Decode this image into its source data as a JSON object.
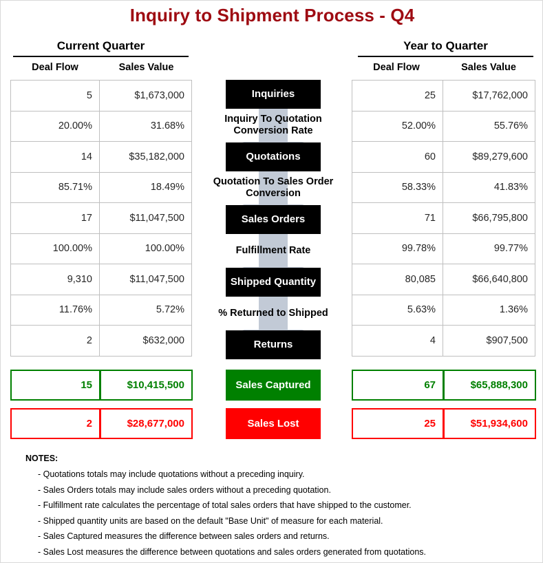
{
  "title": "Inquiry to Shipment Process - Q4",
  "colors": {
    "title": "#9E0B12",
    "stage_box": "#000000",
    "arrow": "#C2CAD6",
    "captured": "#008000",
    "lost": "#FF0000",
    "grid": "#BFBFBF"
  },
  "left_panel": {
    "header": "Current Quarter",
    "columns": [
      "Deal Flow",
      "Sales Value"
    ],
    "rows": [
      {
        "deal_flow": "5",
        "sales_value": "$1,673,000"
      },
      {
        "deal_flow": "20.00%",
        "sales_value": "31.68%"
      },
      {
        "deal_flow": "14",
        "sales_value": "$35,182,000"
      },
      {
        "deal_flow": "85.71%",
        "sales_value": "18.49%"
      },
      {
        "deal_flow": "17",
        "sales_value": "$11,047,500"
      },
      {
        "deal_flow": "100.00%",
        "sales_value": "100.00%"
      },
      {
        "deal_flow": "9,310",
        "sales_value": "$11,047,500"
      },
      {
        "deal_flow": "11.76%",
        "sales_value": "5.72%"
      },
      {
        "deal_flow": "2",
        "sales_value": "$632,000"
      }
    ],
    "captured": {
      "deal_flow": "15",
      "sales_value": "$10,415,500"
    },
    "lost": {
      "deal_flow": "2",
      "sales_value": "$28,677,000"
    }
  },
  "right_panel": {
    "header": "Year to Quarter",
    "columns": [
      "Deal Flow",
      "Sales Value"
    ],
    "rows": [
      {
        "deal_flow": "25",
        "sales_value": "$17,762,000"
      },
      {
        "deal_flow": "52.00%",
        "sales_value": "55.76%"
      },
      {
        "deal_flow": "60",
        "sales_value": "$89,279,600"
      },
      {
        "deal_flow": "58.33%",
        "sales_value": "41.83%"
      },
      {
        "deal_flow": "71",
        "sales_value": "$66,795,800"
      },
      {
        "deal_flow": "99.78%",
        "sales_value": "99.77%"
      },
      {
        "deal_flow": "80,085",
        "sales_value": "$66,640,800"
      },
      {
        "deal_flow": "5.63%",
        "sales_value": "1.36%"
      },
      {
        "deal_flow": "4",
        "sales_value": "$907,500"
      }
    ],
    "captured": {
      "deal_flow": "67",
      "sales_value": "$65,888,300"
    },
    "lost": {
      "deal_flow": "25",
      "sales_value": "$51,934,600"
    }
  },
  "flow": {
    "stages": [
      {
        "label": "Inquiries"
      },
      {
        "label": "Quotations"
      },
      {
        "label": "Sales Orders"
      },
      {
        "label": "Shipped Quantity"
      },
      {
        "label": "Returns"
      }
    ],
    "metrics": [
      {
        "label": "Inquiry To Quotation Conversion Rate"
      },
      {
        "label": "Quotation To Sales Order Conversion"
      },
      {
        "label": "Fulfillment Rate"
      },
      {
        "label": "% Returned to Shipped"
      }
    ],
    "summaries": [
      {
        "label": "Sales Captured"
      },
      {
        "label": "Sales Lost"
      }
    ]
  },
  "notes": {
    "title": "NOTES:",
    "lines": [
      "- Quotations totals may include quotations without a preceding inquiry.",
      "- Sales Orders totals may include sales orders without a preceding quotation.",
      "- Fulfillment rate calculates the percentage of total sales orders that have shipped to the customer.",
      "- Shipped quantity units are based on the default \"Base Unit\" of measure for each material.",
      "- Sales Captured measures the difference between sales orders and returns.",
      "- Sales Lost measures the difference between quotations and sales orders generated from quotations."
    ]
  }
}
